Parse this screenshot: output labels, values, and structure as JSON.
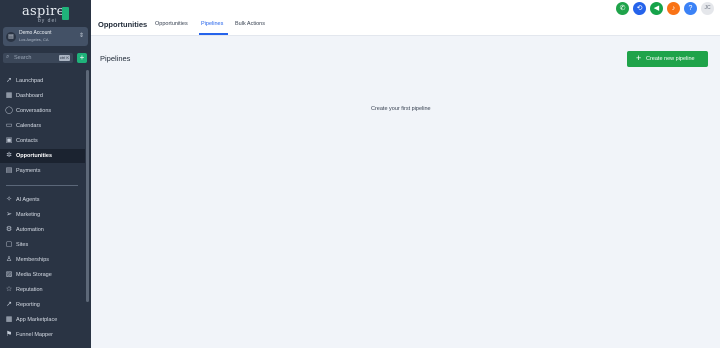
{
  "logo": {
    "text": "aspire",
    "sub": "by dei"
  },
  "account": {
    "name": "Demo Account",
    "sub": "Los Angeles, CA"
  },
  "search": {
    "placeholder": "Search",
    "shortcut": "ctrl K"
  },
  "nav": {
    "items": [
      {
        "label": "Launchpad",
        "icon": "rocket-icon"
      },
      {
        "label": "Dashboard",
        "icon": "dashboard-icon"
      },
      {
        "label": "Conversations",
        "icon": "chat-icon"
      },
      {
        "label": "Calendars",
        "icon": "calendar-icon"
      },
      {
        "label": "Contacts",
        "icon": "contacts-icon"
      },
      {
        "label": "Opportunities",
        "icon": "opportunities-icon",
        "active": true
      },
      {
        "label": "Payments",
        "icon": "payments-icon"
      },
      {
        "label": "AI Agents",
        "icon": "ai-agents-icon"
      },
      {
        "label": "Marketing",
        "icon": "marketing-icon"
      },
      {
        "label": "Automation",
        "icon": "automation-icon"
      },
      {
        "label": "Sites",
        "icon": "sites-icon"
      },
      {
        "label": "Memberships",
        "icon": "memberships-icon"
      },
      {
        "label": "Media Storage",
        "icon": "media-icon"
      },
      {
        "label": "Reputation",
        "icon": "star-icon"
      },
      {
        "label": "Reporting",
        "icon": "reporting-icon"
      },
      {
        "label": "App Marketplace",
        "icon": "marketplace-icon"
      },
      {
        "label": "Funnel Mapper",
        "icon": "funnel-icon"
      }
    ]
  },
  "header": {
    "title": "Opportunities",
    "tabs": [
      {
        "label": "Opportunities"
      },
      {
        "label": "Pipelines",
        "active": true
      },
      {
        "label": "Bulk Actions"
      }
    ],
    "avatar_initials": "JC",
    "icons": [
      "phone-icon",
      "sync-icon",
      "megaphone-icon",
      "bell-icon",
      "help-icon"
    ],
    "colors": {
      "phone": "#1fa34a",
      "sync": "#2563eb",
      "megaphone": "#16a34a",
      "bell": "#f97316",
      "help": "#3b82f6"
    }
  },
  "main": {
    "section_title": "Pipelines",
    "create_button": "Create new pipeline",
    "empty_message": "Create your first pipeline"
  },
  "colors": {
    "sidebar": "#2a3444",
    "accent_green": "#1fa34a",
    "tab_active": "#2563eb",
    "background": "#f1f4f9"
  }
}
